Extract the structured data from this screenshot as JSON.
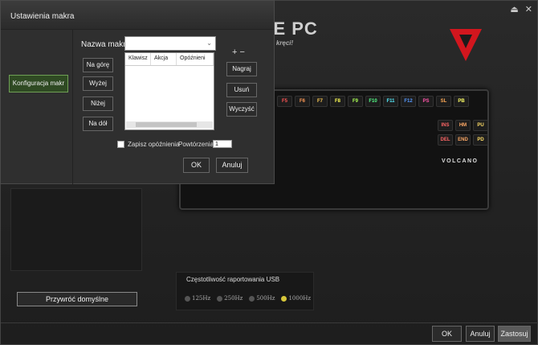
{
  "app": {
    "restore_label": "Przywróć domyślne",
    "usb_title": "Częstotliwość raportowania USB",
    "usb_options": [
      "125Hz",
      "250Hz",
      "500Hz",
      "1000Hz"
    ],
    "usb_selected": "1000Hz",
    "ok_label": "OK",
    "cancel_label": "Anuluj",
    "apply_label": "Zastosuj",
    "brand_label": "VOLCANO",
    "watermark_brand": "PURE PC",
    "watermark_tagline": "Wiemy co się kręci!"
  },
  "dialog": {
    "title": "Ustawienia makra",
    "config_label": "Konfiguracja makr",
    "macro_name_label": "Nazwa makra",
    "macro_name_value": "",
    "columns": [
      "Klawisz",
      "Akcja",
      "Opóźnieni"
    ],
    "move_top": "Na górę",
    "move_up": "Wyżej",
    "move_down": "Niżej",
    "move_bottom": "Na dół",
    "record": "Nagraj",
    "delete": "Usuń",
    "clear": "Wyczyść",
    "plus_minus": "+ −",
    "save_delay_label": "Zapisz opóźnienia",
    "repeats_label": "Powtórzenia",
    "repeats_value": "1",
    "ok_label": "OK",
    "cancel_label": "Anuluj"
  },
  "colors": {
    "brand_red": "#d2161e",
    "config_green": "#2f4a23",
    "selected_radio": "#d6c63a"
  },
  "icons": [
    "minimize-icon",
    "close-icon",
    "volcano-logo-icon",
    "chevron-down-icon",
    "radio-icon"
  ],
  "keyboard": {
    "row1": [
      "F5",
      "F6",
      "F7",
      "F8",
      "F9",
      "F10",
      "F11",
      "F12",
      "PS",
      "SL",
      "PB"
    ],
    "row2": [
      "INS",
      "HM",
      "PU"
    ],
    "row3": [
      "DEL",
      "END",
      "PD"
    ]
  }
}
